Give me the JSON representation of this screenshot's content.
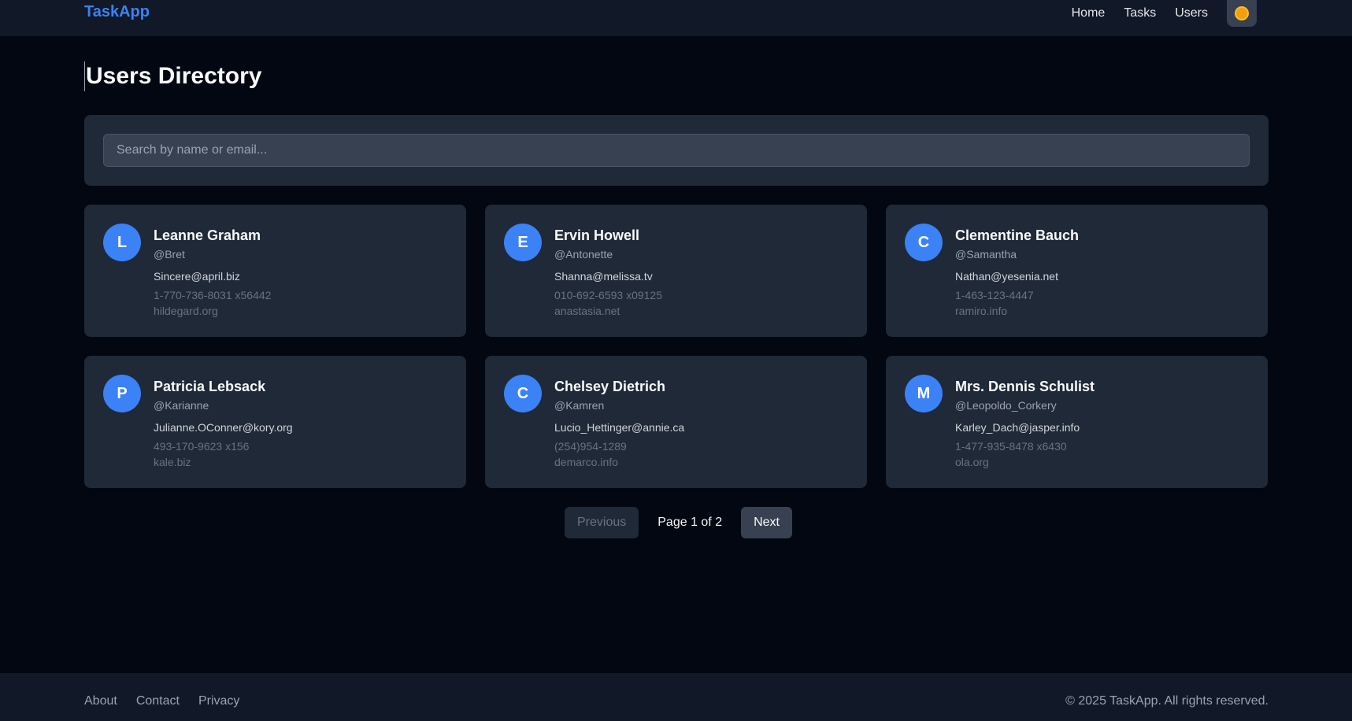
{
  "header": {
    "brand": "TaskApp",
    "nav": [
      "Home",
      "Tasks",
      "Users"
    ],
    "theme_icon": "sun-icon"
  },
  "main": {
    "title": "Users Directory",
    "search": {
      "placeholder": "Search by name or email...",
      "value": ""
    },
    "users": [
      {
        "initial": "L",
        "name": "Leanne Graham",
        "username": "@Bret",
        "email": "Sincere@april.biz",
        "phone": "1-770-736-8031 x56442",
        "website": "hildegard.org"
      },
      {
        "initial": "E",
        "name": "Ervin Howell",
        "username": "@Antonette",
        "email": "Shanna@melissa.tv",
        "phone": "010-692-6593 x09125",
        "website": "anastasia.net"
      },
      {
        "initial": "C",
        "name": "Clementine Bauch",
        "username": "@Samantha",
        "email": "Nathan@yesenia.net",
        "phone": "1-463-123-4447",
        "website": "ramiro.info"
      },
      {
        "initial": "P",
        "name": "Patricia Lebsack",
        "username": "@Karianne",
        "email": "Julianne.OConner@kory.org",
        "phone": "493-170-9623 x156",
        "website": "kale.biz"
      },
      {
        "initial": "C",
        "name": "Chelsey Dietrich",
        "username": "@Kamren",
        "email": "Lucio_Hettinger@annie.ca",
        "phone": "(254)954-1289",
        "website": "demarco.info"
      },
      {
        "initial": "M",
        "name": "Mrs. Dennis Schulist",
        "username": "@Leopoldo_Corkery",
        "email": "Karley_Dach@jasper.info",
        "phone": "1-477-935-8478 x6430",
        "website": "ola.org"
      }
    ],
    "pagination": {
      "previous_label": "Previous",
      "page_info": "Page 1 of 2",
      "next_label": "Next"
    }
  },
  "footer": {
    "links": [
      "About",
      "Contact",
      "Privacy"
    ],
    "copyright": "© 2025 TaskApp. All rights reserved."
  },
  "colors": {
    "background": "#030712",
    "surface": "#1f2937",
    "accent": "#3b82f6"
  }
}
